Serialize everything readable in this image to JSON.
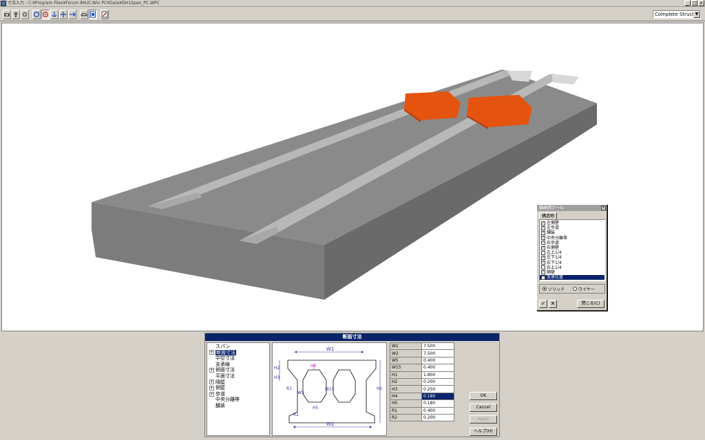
{
  "window": {
    "title": "寸法入力 - C:¥Program Files¥Forum 8¥UC-Win PC¥Data¥DH1Span_PC.WPC",
    "minimize_glyph": "_",
    "maximize_glyph": "□",
    "close_glyph": "x"
  },
  "toolbar": {
    "buttons": [
      "camera-icon",
      "light-icon",
      "settings-icon",
      "rotate-icon",
      "orbit-icon",
      "anchor-icon",
      "move-icon",
      "pan-icon",
      "bridge-view-icon",
      "panel-view-icon",
      "tool-icon"
    ],
    "view_select": {
      "value": "Complete Structur",
      "arrow": "▼"
    }
  },
  "viewport": {
    "colors": {
      "slab_top": "#8c8c8c",
      "slab_side": "#6e6e6e",
      "slab_front": "#7a7a7a",
      "groove": "#b4b4b4",
      "bearing": "#e0500f"
    }
  },
  "structure_window": {
    "title": "描画用ツール",
    "close_glyph": "x",
    "tab": "構造物",
    "items": [
      {
        "label": "左側壁",
        "checked": true
      },
      {
        "label": "左歩道",
        "checked": true
      },
      {
        "label": "舗装",
        "checked": true
      },
      {
        "label": "中央分離帯",
        "checked": true
      },
      {
        "label": "右歩道",
        "checked": true
      },
      {
        "label": "右側壁",
        "checked": true
      },
      {
        "label": "左上1/4",
        "checked": false
      },
      {
        "label": "左下1/4",
        "checked": true
      },
      {
        "label": "右下1/4",
        "checked": true
      },
      {
        "label": "右上1/4",
        "checked": false
      },
      {
        "label": "隔壁",
        "checked": true
      },
      {
        "label": "支承位置",
        "checked": false,
        "selected": true
      }
    ],
    "check_glyph": "✓",
    "radio_solid": "ソリッド",
    "radio_wire": "ワイヤー",
    "ok_glyph": "✓",
    "cancel_glyph": "✕",
    "close_button": "閉じる(C)"
  },
  "panel": {
    "title": "断面寸法",
    "tree": [
      {
        "label": "スパン",
        "exp": "",
        "indent": 0
      },
      {
        "label": "断面寸法",
        "exp": "⊞",
        "indent": 1,
        "selected": true
      },
      {
        "label": "中空寸法",
        "exp": "",
        "indent": 1
      },
      {
        "label": "支承線",
        "exp": "",
        "indent": 1
      },
      {
        "label": "側面寸法",
        "exp": "⊞",
        "indent": 1
      },
      {
        "label": "平面寸法",
        "exp": "",
        "indent": 1
      },
      {
        "label": "隔壁",
        "exp": "⊞",
        "indent": 1
      },
      {
        "label": "側壁",
        "exp": "⊞",
        "indent": 1
      },
      {
        "label": "歩道",
        "exp": "⊞",
        "indent": 1
      },
      {
        "label": "中央分離帯",
        "exp": "",
        "indent": 1
      },
      {
        "label": "舗装",
        "exp": "",
        "indent": 1
      }
    ],
    "diagram_labels": {
      "w1": "W1",
      "w2": "W2",
      "w5": "W5",
      "w15": "W15",
      "h1": "H1",
      "h2": "H2",
      "h3": "H3",
      "h4": "H4",
      "h5": "H5",
      "r1": "R1",
      "r2": "R2"
    },
    "dimensions": [
      {
        "key": "W1",
        "value": "7.500"
      },
      {
        "key": "W2",
        "value": "7.500"
      },
      {
        "key": "W5",
        "value": "0.400"
      },
      {
        "key": "W15",
        "value": "0.400"
      },
      {
        "key": "H1",
        "value": "1.800"
      },
      {
        "key": "H2",
        "value": "0.200"
      },
      {
        "key": "H3",
        "value": "0.250"
      },
      {
        "key": "H4",
        "value": "0.180",
        "selected": true
      },
      {
        "key": "H5",
        "value": "0.180"
      },
      {
        "key": "R1",
        "value": "0.400"
      },
      {
        "key": "R2",
        "value": "0.200"
      }
    ],
    "buttons": {
      "ok": "OK",
      "cancel": "Cancel",
      "apply": "Apply",
      "help": "ヘルプ(H)"
    }
  }
}
